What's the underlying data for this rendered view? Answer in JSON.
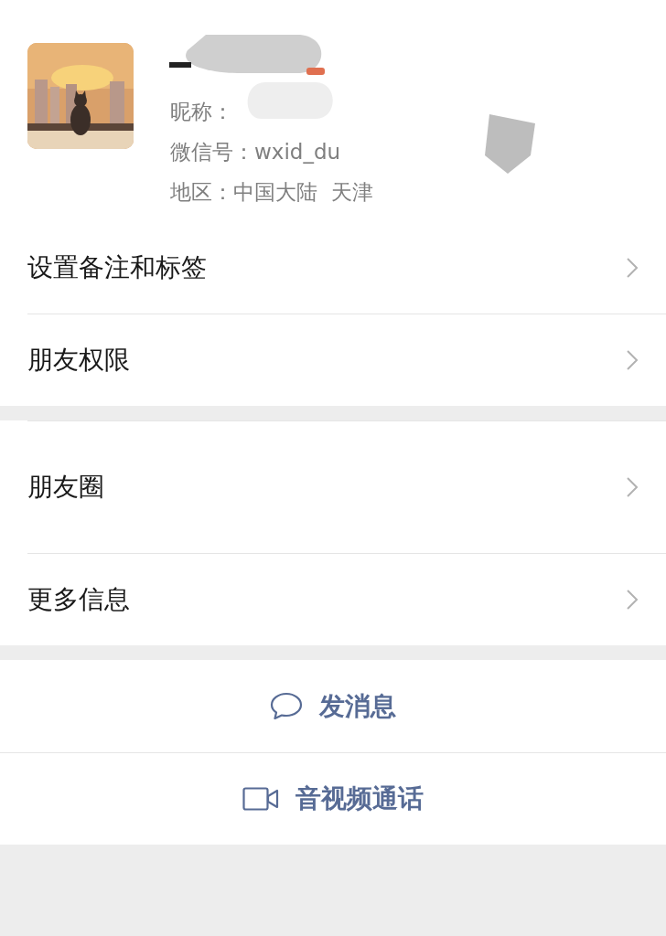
{
  "profile": {
    "nickname": "昵称：",
    "wechat_id": "微信号：wxid_du",
    "region": "地区：中国大陆  天津"
  },
  "groups": [
    {
      "rows": [
        {
          "label": "设置备注和标签",
          "kind": "normal"
        },
        {
          "label": "朋友权限",
          "kind": "normal"
        }
      ]
    },
    {
      "rows": [
        {
          "label": "朋友圈",
          "kind": "tall"
        },
        {
          "label": "更多信息",
          "kind": "normal"
        }
      ]
    }
  ],
  "actions": [
    {
      "label": "发消息",
      "kind": "message"
    },
    {
      "label": "音视频通话",
      "kind": "video"
    }
  ]
}
